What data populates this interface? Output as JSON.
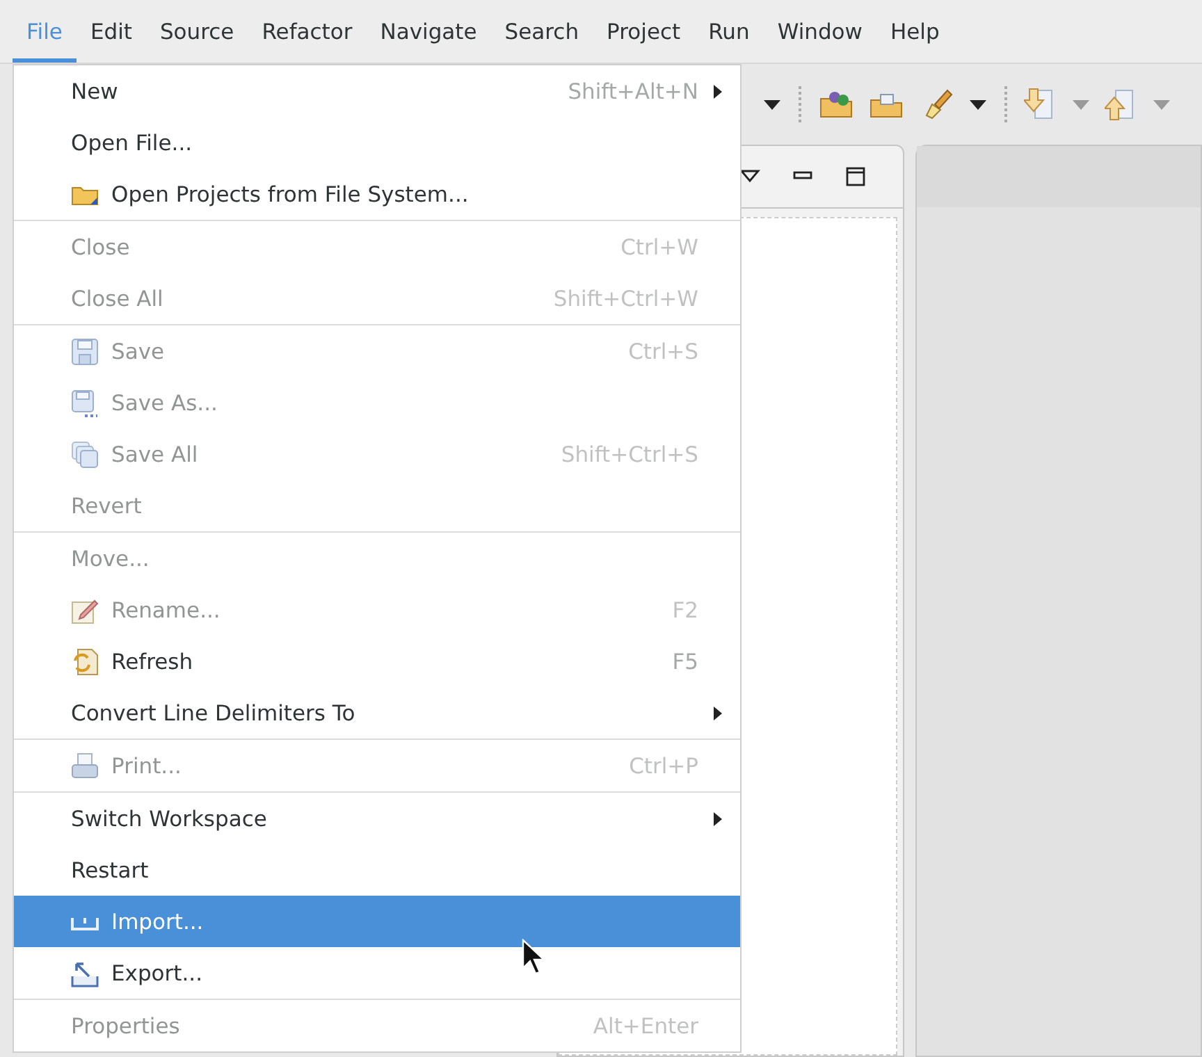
{
  "menubar": [
    {
      "label": "File",
      "selected": true
    },
    {
      "label": "Edit",
      "selected": false
    },
    {
      "label": "Source",
      "selected": false
    },
    {
      "label": "Refactor",
      "selected": false
    },
    {
      "label": "Navigate",
      "selected": false
    },
    {
      "label": "Search",
      "selected": false
    },
    {
      "label": "Project",
      "selected": false
    },
    {
      "label": "Run",
      "selected": false
    },
    {
      "label": "Window",
      "selected": false
    },
    {
      "label": "Help",
      "selected": false
    }
  ],
  "menu": {
    "groups": [
      {
        "items": [
          {
            "label": "New",
            "shortcut": "Shift+Alt+N",
            "submenu": true,
            "disabled": false,
            "selected": false
          },
          {
            "label": "Open File...",
            "disabled": false,
            "selected": false
          },
          {
            "label": "Open Projects from File System...",
            "kind": "folder",
            "disabled": false,
            "selected": false
          }
        ]
      },
      {
        "items": [
          {
            "label": "Close",
            "shortcut": "Ctrl+W",
            "disabled": true,
            "selected": false
          },
          {
            "label": "Close All",
            "shortcut": "Shift+Ctrl+W",
            "disabled": true,
            "selected": false
          }
        ]
      },
      {
        "items": [
          {
            "label": "Save",
            "shortcut": "Ctrl+S",
            "kind": "save",
            "disabled": true,
            "selected": false
          },
          {
            "label": "Save As...",
            "kind": "save-as",
            "disabled": true,
            "selected": false
          },
          {
            "label": "Save All",
            "shortcut": "Shift+Ctrl+S",
            "kind": "save-all",
            "disabled": true,
            "selected": false
          },
          {
            "label": "Revert",
            "disabled": true,
            "selected": false
          }
        ]
      },
      {
        "items": [
          {
            "label": "Move...",
            "disabled": true,
            "selected": false
          },
          {
            "label": "Rename...",
            "shortcut": "F2",
            "kind": "rename",
            "disabled": true,
            "selected": false
          },
          {
            "label": "Refresh",
            "shortcut": "F5",
            "kind": "refresh",
            "disabled": false,
            "selected": false
          },
          {
            "label": "Convert Line Delimiters To",
            "submenu": true,
            "disabled": false,
            "selected": false
          }
        ]
      },
      {
        "items": [
          {
            "label": "Print...",
            "shortcut": "Ctrl+P",
            "kind": "print",
            "disabled": true,
            "selected": false
          }
        ]
      },
      {
        "items": [
          {
            "label": "Switch Workspace",
            "submenu": true,
            "disabled": false,
            "selected": false
          },
          {
            "label": "Restart",
            "disabled": false,
            "selected": false
          },
          {
            "label": "Import...",
            "kind": "import",
            "disabled": false,
            "selected": true
          },
          {
            "label": "Export...",
            "kind": "export",
            "disabled": false,
            "selected": false
          }
        ]
      },
      {
        "items": [
          {
            "label": "Properties",
            "shortcut": "Alt+Enter",
            "disabled": true,
            "selected": false
          }
        ]
      }
    ]
  }
}
